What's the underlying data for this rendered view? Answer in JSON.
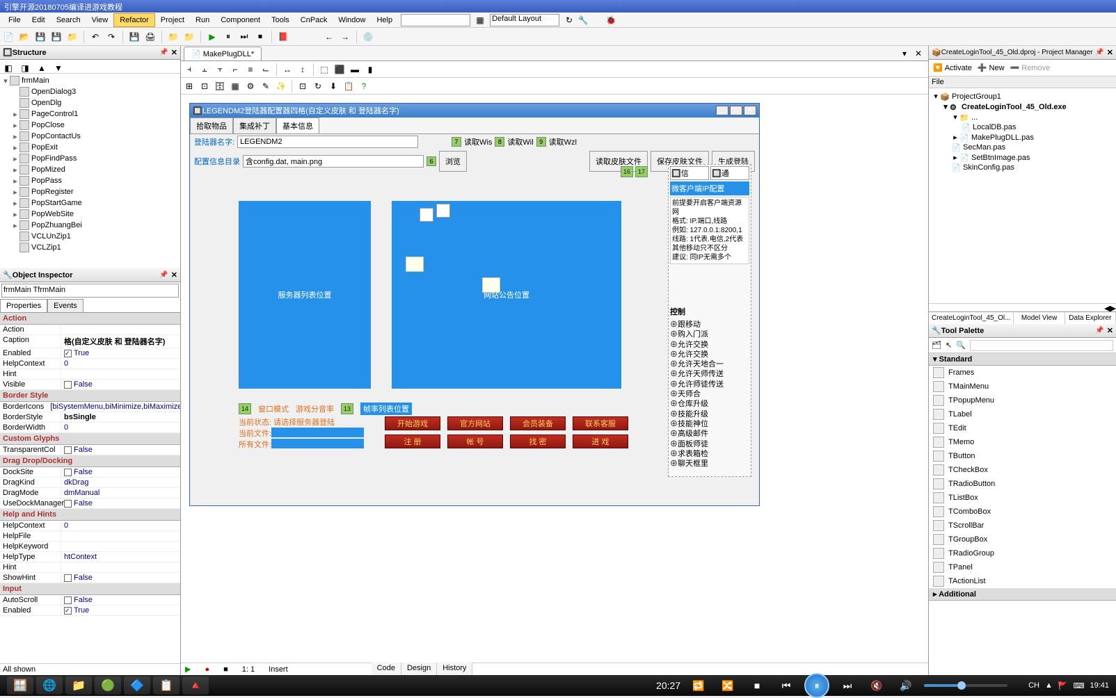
{
  "window_title": "引擎开源20180705编译进游戏教程",
  "menu": [
    "File",
    "Edit",
    "Search",
    "View",
    "Refactor",
    "Project",
    "Run",
    "Component",
    "Tools",
    "CnPack",
    "Window",
    "Help"
  ],
  "layout_combo": "Default Layout",
  "structure": {
    "title": "Structure",
    "root": "frmMain",
    "items": [
      "OpenDialog3",
      "OpenDlg",
      "PageControl1",
      "PopClose",
      "PopContactUs",
      "PopExit",
      "PopFindPass",
      "PopMized",
      "PopPass",
      "PopRegister",
      "PopStartGame",
      "PopWebSite",
      "PopZhuangBei",
      "VCLUnZip1",
      "VCLZip1"
    ]
  },
  "inspector": {
    "title": "Object Inspector",
    "combo": "frmMain TfrmMain",
    "tabs": [
      "Properties",
      "Events"
    ],
    "cats": {
      "Action": [
        {
          "k": "Action",
          "v": ""
        },
        {
          "k": "Caption",
          "v": "格(自定义皮肤 和 登陆器名字)",
          "bold": true
        },
        {
          "k": "Enabled",
          "v": "True",
          "chk": true
        },
        {
          "k": "HelpContext",
          "v": "0"
        },
        {
          "k": "Hint",
          "v": ""
        },
        {
          "k": "Visible",
          "v": "False",
          "chk": false
        }
      ],
      "Border Style": [
        {
          "k": "BorderIcons",
          "v": "[biSystemMenu,biMinimize,biMaximize]"
        },
        {
          "k": "BorderStyle",
          "v": "bsSingle",
          "bold": true
        },
        {
          "k": "BorderWidth",
          "v": "0"
        }
      ],
      "Custom Glyphs": [
        {
          "k": "TransparentCol",
          "v": "False",
          "chk": false
        }
      ],
      "Drag Drop/Docking": [
        {
          "k": "DockSite",
          "v": "False",
          "chk": false
        },
        {
          "k": "DragKind",
          "v": "dkDrag"
        },
        {
          "k": "DragMode",
          "v": "dmManual"
        },
        {
          "k": "UseDockManager",
          "v": "False",
          "chk": false
        }
      ],
      "Help and Hints": [
        {
          "k": "HelpContext",
          "v": "0"
        },
        {
          "k": "HelpFile",
          "v": ""
        },
        {
          "k": "HelpKeyword",
          "v": ""
        },
        {
          "k": "HelpType",
          "v": "htContext"
        },
        {
          "k": "Hint",
          "v": ""
        },
        {
          "k": "ShowHint",
          "v": "False",
          "chk": false
        }
      ],
      "Input": [
        {
          "k": "AutoScroll",
          "v": "False",
          "chk": false
        },
        {
          "k": "Enabled",
          "v": "True",
          "chk": true
        }
      ]
    },
    "footer": "All shown"
  },
  "doc_tab": "MakePlugDLL*",
  "form": {
    "title": "LEGENDM2登陆器配置器四格(自定义皮肤 和 登陆器名字)",
    "tabs": [
      "拾取物品",
      "集成补丁",
      "基本信息"
    ],
    "row1_label": "登陆器名字:",
    "row1_value": "LEGENDM2",
    "read_btns": [
      "读取Wis",
      "读取Wil",
      "读取Wzl"
    ],
    "row2_label": "配置信息目录",
    "row2_value": "含config.dat, main.png",
    "browse": "浏览",
    "top_btns": [
      "读取皮肤文件",
      "保存皮肤文件",
      "生成登陆"
    ],
    "badges": [
      "16",
      "17"
    ],
    "panel1": "服务器列表位置",
    "panel2": "网站公告位置",
    "bottom_labels": [
      "窗口模式",
      "游戏分音率",
      "帧率列表位置"
    ],
    "status_labels": [
      "当前状态: 请选择服务器登陆",
      "当前文件:",
      "所有文件:"
    ],
    "red_row1": [
      "开始游戏",
      "官方网站",
      "会员装备",
      "联系客服"
    ],
    "red_row2": [
      "注 册",
      "帐    号",
      "找    密",
      "进    戏"
    ],
    "side_hdr": "微客户端IP配置",
    "side_body": "前提要开启客户端资源网\n格式: IP.端口,线路\n例如: 127.0.0.1:8200,1\n线路: 1代表.电信,2代表\n其他移动只不区分\n建议: 同IP无需多个",
    "side_tabs": [
      "信",
      "通"
    ],
    "side_list_hdr": "控制",
    "side_list": [
      "跟移动",
      "购入门派",
      "允许交换",
      "允许交换",
      "允许天地合一",
      "允许天师传送",
      "允许师徒传送",
      "天师合",
      "仓库升级",
      "技能升级",
      "技能神位",
      "高级邮件",
      "面板师徒",
      "求表箱检",
      "聊天框里"
    ]
  },
  "bottom_tabs": [
    "Code",
    "Design",
    "History"
  ],
  "status": {
    "pos": "1: 1",
    "mode": "Insert"
  },
  "pm": {
    "title": "CreateLoginTool_45_Old.dproj - Project Manager",
    "actions": [
      "Activate",
      "New",
      "Remove"
    ],
    "file_hdr": "File",
    "group": "ProjectGroup1",
    "exe": "CreateLoginTool_45_Old.exe",
    "files": [
      "LocalDB.pas",
      "MakePlugDLL.pas",
      "SecMan.pas",
      "SetBtnImage.pas",
      "SkinConfig.pas"
    ],
    "tabs": [
      "CreateLoginTool_45_Ol...",
      "Model View",
      "Data Explorer"
    ]
  },
  "palette": {
    "title": "Tool Palette",
    "cat1": "Standard",
    "items": [
      "Frames",
      "TMainMenu",
      "TPopupMenu",
      "TLabel",
      "TEdit",
      "TMemo",
      "TButton",
      "TCheckBox",
      "TRadioButton",
      "TListBox",
      "TComboBox",
      "TScrollBar",
      "TGroupBox",
      "TRadioGroup",
      "TPanel",
      "TActionList"
    ],
    "cat2": "Additional"
  },
  "media": {
    "time": "20:27",
    "clock": "19:41",
    "lang": "CH"
  }
}
